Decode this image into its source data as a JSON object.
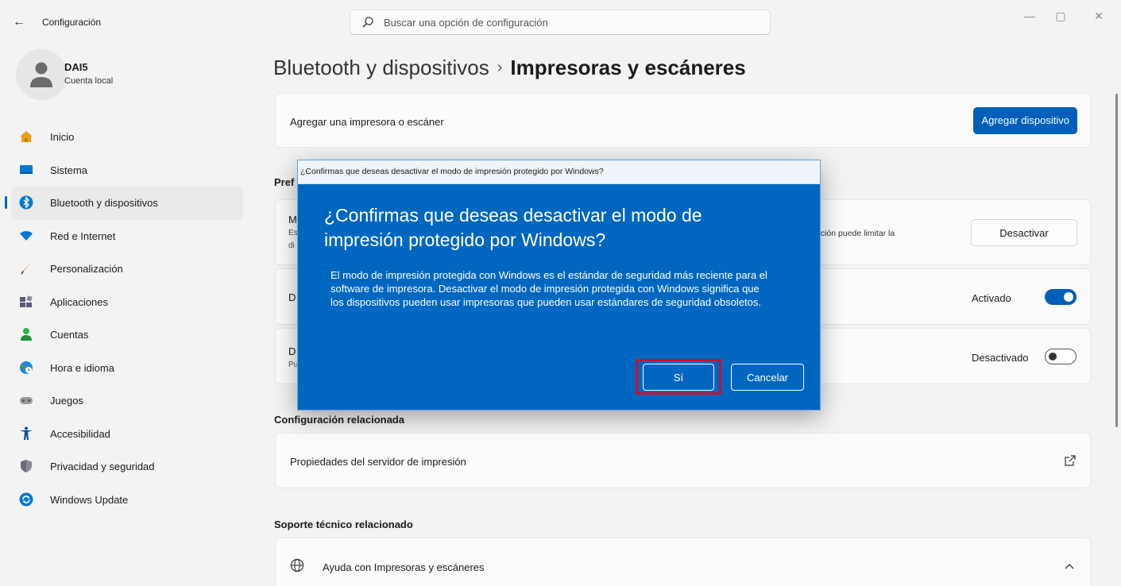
{
  "titlebar": {
    "back_icon": "←",
    "app_title": "Configuración",
    "search_placeholder": "Buscar una opción de configuración",
    "minimize": "—",
    "maximize": "▢",
    "close": "✕"
  },
  "profile": {
    "name": "DAI5",
    "account_type": "Cuenta local"
  },
  "sidebar": {
    "items": [
      {
        "label": "Inicio",
        "icon": "home-icon",
        "color": "#e8a317"
      },
      {
        "label": "Sistema",
        "icon": "monitor-icon",
        "color": "#0078d4"
      },
      {
        "label": "Bluetooth y dispositivos",
        "icon": "bluetooth-icon",
        "color": "#0078d4",
        "active": true
      },
      {
        "label": "Red e Internet",
        "icon": "wifi-icon",
        "color": "#0078d4"
      },
      {
        "label": "Personalización",
        "icon": "brush-icon",
        "color": "#e07a2e"
      },
      {
        "label": "Aplicaciones",
        "icon": "apps-icon",
        "color": "#5a5a7a"
      },
      {
        "label": "Cuentas",
        "icon": "user-icon",
        "color": "#2db34a"
      },
      {
        "label": "Hora e idioma",
        "icon": "globe-clock-icon",
        "color": "#1e88e5"
      },
      {
        "label": "Juegos",
        "icon": "gamepad-icon",
        "color": "#8a8a8a"
      },
      {
        "label": "Accesibilidad",
        "icon": "accessibility-icon",
        "color": "#0050a0"
      },
      {
        "label": "Privacidad y seguridad",
        "icon": "shield-icon",
        "color": "#6b6b7b"
      },
      {
        "label": "Windows Update",
        "icon": "update-icon",
        "color": "#0078d4"
      }
    ]
  },
  "main": {
    "breadcrumb_parent": "Bluetooth y dispositivos",
    "breadcrumb_sep": "›",
    "breadcrumb_current": "Impresoras y escáneres",
    "add_printer_label": "Agregar una impresora o escáner",
    "add_device_button": "Agregar dispositivo",
    "preferences_clipped": "Pref",
    "row1_clip_title": "M",
    "row1_clip_sub1": "Es",
    "row1_clip_sub2": "di",
    "row1_right_text": "pción puede limitar la",
    "row1_button": "Desactivar",
    "row2_clip": "D",
    "row2_status": "Activado",
    "row3_clip": "D",
    "row3_clip_sub": "Pu",
    "row3_status": "Desactivado",
    "related_config_title": "Configuración relacionada",
    "print_server_label": "Propiedades del servidor de impresión",
    "support_title": "Soporte técnico relacionado",
    "help_label": "Ayuda con Impresoras y escáneres"
  },
  "dialog": {
    "window_title": "¿Confirmas que deseas desactivar el modo de impresión protegido por Windows?",
    "heading": "¿Confirmas que deseas desactivar el modo de impresión protegido por Windows?",
    "body": "El modo de impresión protegida con Windows es el estándar de seguridad más reciente para el software de impresora. Desactivar el modo de impresión protegida con Windows significa que los dispositivos pueden usar impresoras que pueden usar estándares de seguridad obsoletos.",
    "yes_button": "Sí",
    "cancel_button": "Cancelar",
    "highlight_color": "#c8102e"
  },
  "colors": {
    "accent": "#005fb8",
    "dialog_bg": "#0067c0"
  }
}
